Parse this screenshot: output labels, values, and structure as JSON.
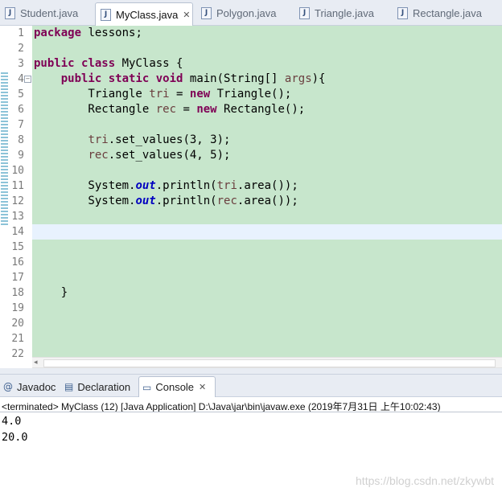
{
  "editor_tabs": [
    {
      "label": "Student.java",
      "active": false
    },
    {
      "label": "MyClass.java",
      "active": true
    },
    {
      "label": "Polygon.java",
      "active": false
    },
    {
      "label": "Triangle.java",
      "active": false
    },
    {
      "label": "Rectangle.java",
      "active": false
    }
  ],
  "tab_close_glyph": "✕",
  "java_icon_letter": "J",
  "fold_glyph": "−",
  "line_numbers": [
    "1",
    "2",
    "3",
    "4",
    "5",
    "6",
    "7",
    "8",
    "9",
    "10",
    "11",
    "12",
    "13",
    "14",
    "15",
    "16",
    "17",
    "18",
    "19",
    "20",
    "21",
    "22"
  ],
  "current_line": 14,
  "code": {
    "l1": [
      "package",
      " lessons;"
    ],
    "l3": [
      "public",
      " ",
      "class",
      " MyClass {"
    ],
    "l4": [
      "    ",
      "public",
      " ",
      "static",
      " ",
      "void",
      " main(String[] ",
      "args",
      "){"
    ],
    "l5": [
      "        Triangle ",
      "tri",
      " = ",
      "new",
      " Triangle();"
    ],
    "l6": [
      "        Rectangle ",
      "rec",
      " = ",
      "new",
      " Rectangle();"
    ],
    "l8": [
      "        ",
      "tri",
      ".set_values(3, 3);"
    ],
    "l9": [
      "        ",
      "rec",
      ".set_values(4, 5);"
    ],
    "l11": [
      "        System.",
      "out",
      ".println(",
      "tri",
      ".area());"
    ],
    "l12": [
      "        System.",
      "out",
      ".println(",
      "rec",
      ".area());"
    ],
    "l18": [
      "    }"
    ]
  },
  "view_tabs": [
    {
      "label": "Javadoc",
      "icon": "@"
    },
    {
      "label": "Declaration",
      "icon": "▤"
    },
    {
      "label": "Console",
      "icon": "▭",
      "active": true
    }
  ],
  "console": {
    "status": "<terminated> MyClass (12) [Java Application] D:\\Java\\jar\\bin\\javaw.exe (2019年7月31日 上午10:02:43)",
    "output": [
      "4.0",
      "20.0"
    ]
  },
  "watermark": "https://blog.csdn.net/zkywbt",
  "colors": {
    "editor_bg": "#c7e6cc",
    "keyword": "#7f0055",
    "variable": "#6a3e3e",
    "static_field": "#0000c0",
    "current_line": "#e8f2fe"
  }
}
